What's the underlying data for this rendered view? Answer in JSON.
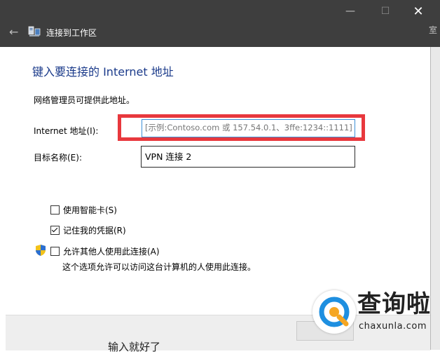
{
  "window": {
    "title": "连接到工作区",
    "side_fragment": "室",
    "close_glyph": "✕",
    "max_glyph": "☐",
    "min_glyph": "—"
  },
  "dialog": {
    "heading": "键入要连接的 Internet 地址",
    "description": "网络管理员可提供此地址。",
    "address_label": "Internet 地址(I):",
    "address_placeholder": "[示例:Contoso.com 或 157.54.0.1、3ffe:1234::1111]",
    "destination_label": "目标名称(E):",
    "destination_value": "VPN 连接 2",
    "options": [
      {
        "label": "使用智能卡(S)",
        "checked": false
      },
      {
        "label": "记住我的凭据(R)",
        "checked": true
      },
      {
        "label": "允许其他人使用此连接(A)",
        "checked": false
      }
    ],
    "allow_note": "这个选项允许可以访问这台计算机的人使用此连接。"
  },
  "background": {
    "bottom_fragment": "输入就好了"
  },
  "watermark": {
    "brand": "查询啦",
    "domain": "chaxunla.com"
  },
  "colors": {
    "titlebar": "#3e3e3e",
    "heading": "#1a3a8a",
    "highlight": "#e8383d",
    "focus_border": "#3c8fd6"
  }
}
